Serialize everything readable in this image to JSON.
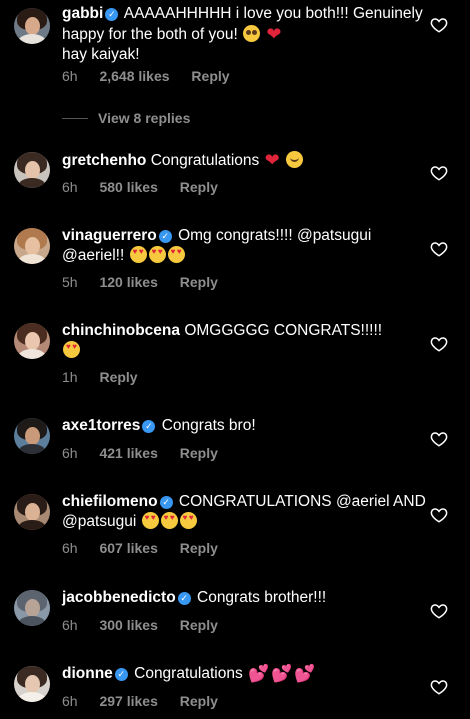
{
  "comments": [
    {
      "username": "gabbi",
      "verified": true,
      "text": "AAAAAHHHHH i love you both!!! Genuinely happy for the both of you!",
      "text2": "hay kaiyak!",
      "time": "6h",
      "likes": "2,648 likes",
      "reply": "Reply"
    },
    {
      "username": "gretchenho",
      "verified": false,
      "text": "Congratulations",
      "time": "6h",
      "likes": "580 likes",
      "reply": "Reply"
    },
    {
      "username": "vinaguerrero",
      "verified": true,
      "text": "Omg congrats!!!! @patsugui @aeriel!!",
      "time": "5h",
      "likes": "120 likes",
      "reply": "Reply"
    },
    {
      "username": "chinchinobcena",
      "verified": false,
      "text": "OMGGGGG CONGRATS!!!!!",
      "time": "1h",
      "likes": "",
      "reply": "Reply"
    },
    {
      "username": "axe1torres",
      "verified": true,
      "text": "Congrats bro!",
      "time": "6h",
      "likes": "421 likes",
      "reply": "Reply"
    },
    {
      "username": "chiefilomeno",
      "verified": true,
      "text": "CONGRATULATIONS @aeriel AND @patsugui",
      "time": "6h",
      "likes": "607 likes",
      "reply": "Reply"
    },
    {
      "username": "jacobbenedicto",
      "verified": true,
      "text": "Congrats brother!!!",
      "time": "6h",
      "likes": "300 likes",
      "reply": "Reply"
    },
    {
      "username": "dionne",
      "verified": true,
      "text": "Congratulations",
      "time": "6h",
      "likes": "297 likes",
      "reply": "Reply"
    }
  ],
  "view_replies": "View 8 replies",
  "colors": {
    "background": "#000000",
    "text": "#ffffff",
    "meta": "#8e8e8e",
    "verified": "#3897f0"
  }
}
